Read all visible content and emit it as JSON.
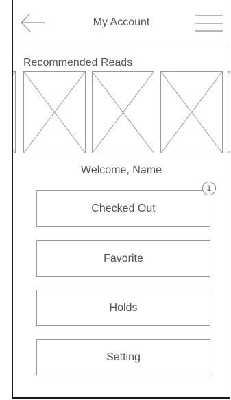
{
  "header": {
    "title": "My Account",
    "back_icon": "arrow-left-icon",
    "menu_icon": "hamburger-menu-icon"
  },
  "recommended": {
    "label": "Recommended Reads",
    "items": [
      "image-placeholder",
      "image-placeholder",
      "image-placeholder",
      "image-placeholder",
      "image-placeholder"
    ]
  },
  "welcome": {
    "text": "Welcome, Name"
  },
  "menu": {
    "checked_out": {
      "label": "Checked Out",
      "badge": "1"
    },
    "favorite": {
      "label": "Favorite"
    },
    "holds": {
      "label": "Holds"
    },
    "setting": {
      "label": "Setting"
    }
  },
  "colors": {
    "text": "#555555",
    "border": "#9a9a9a",
    "frame": "#1a1a1a"
  }
}
